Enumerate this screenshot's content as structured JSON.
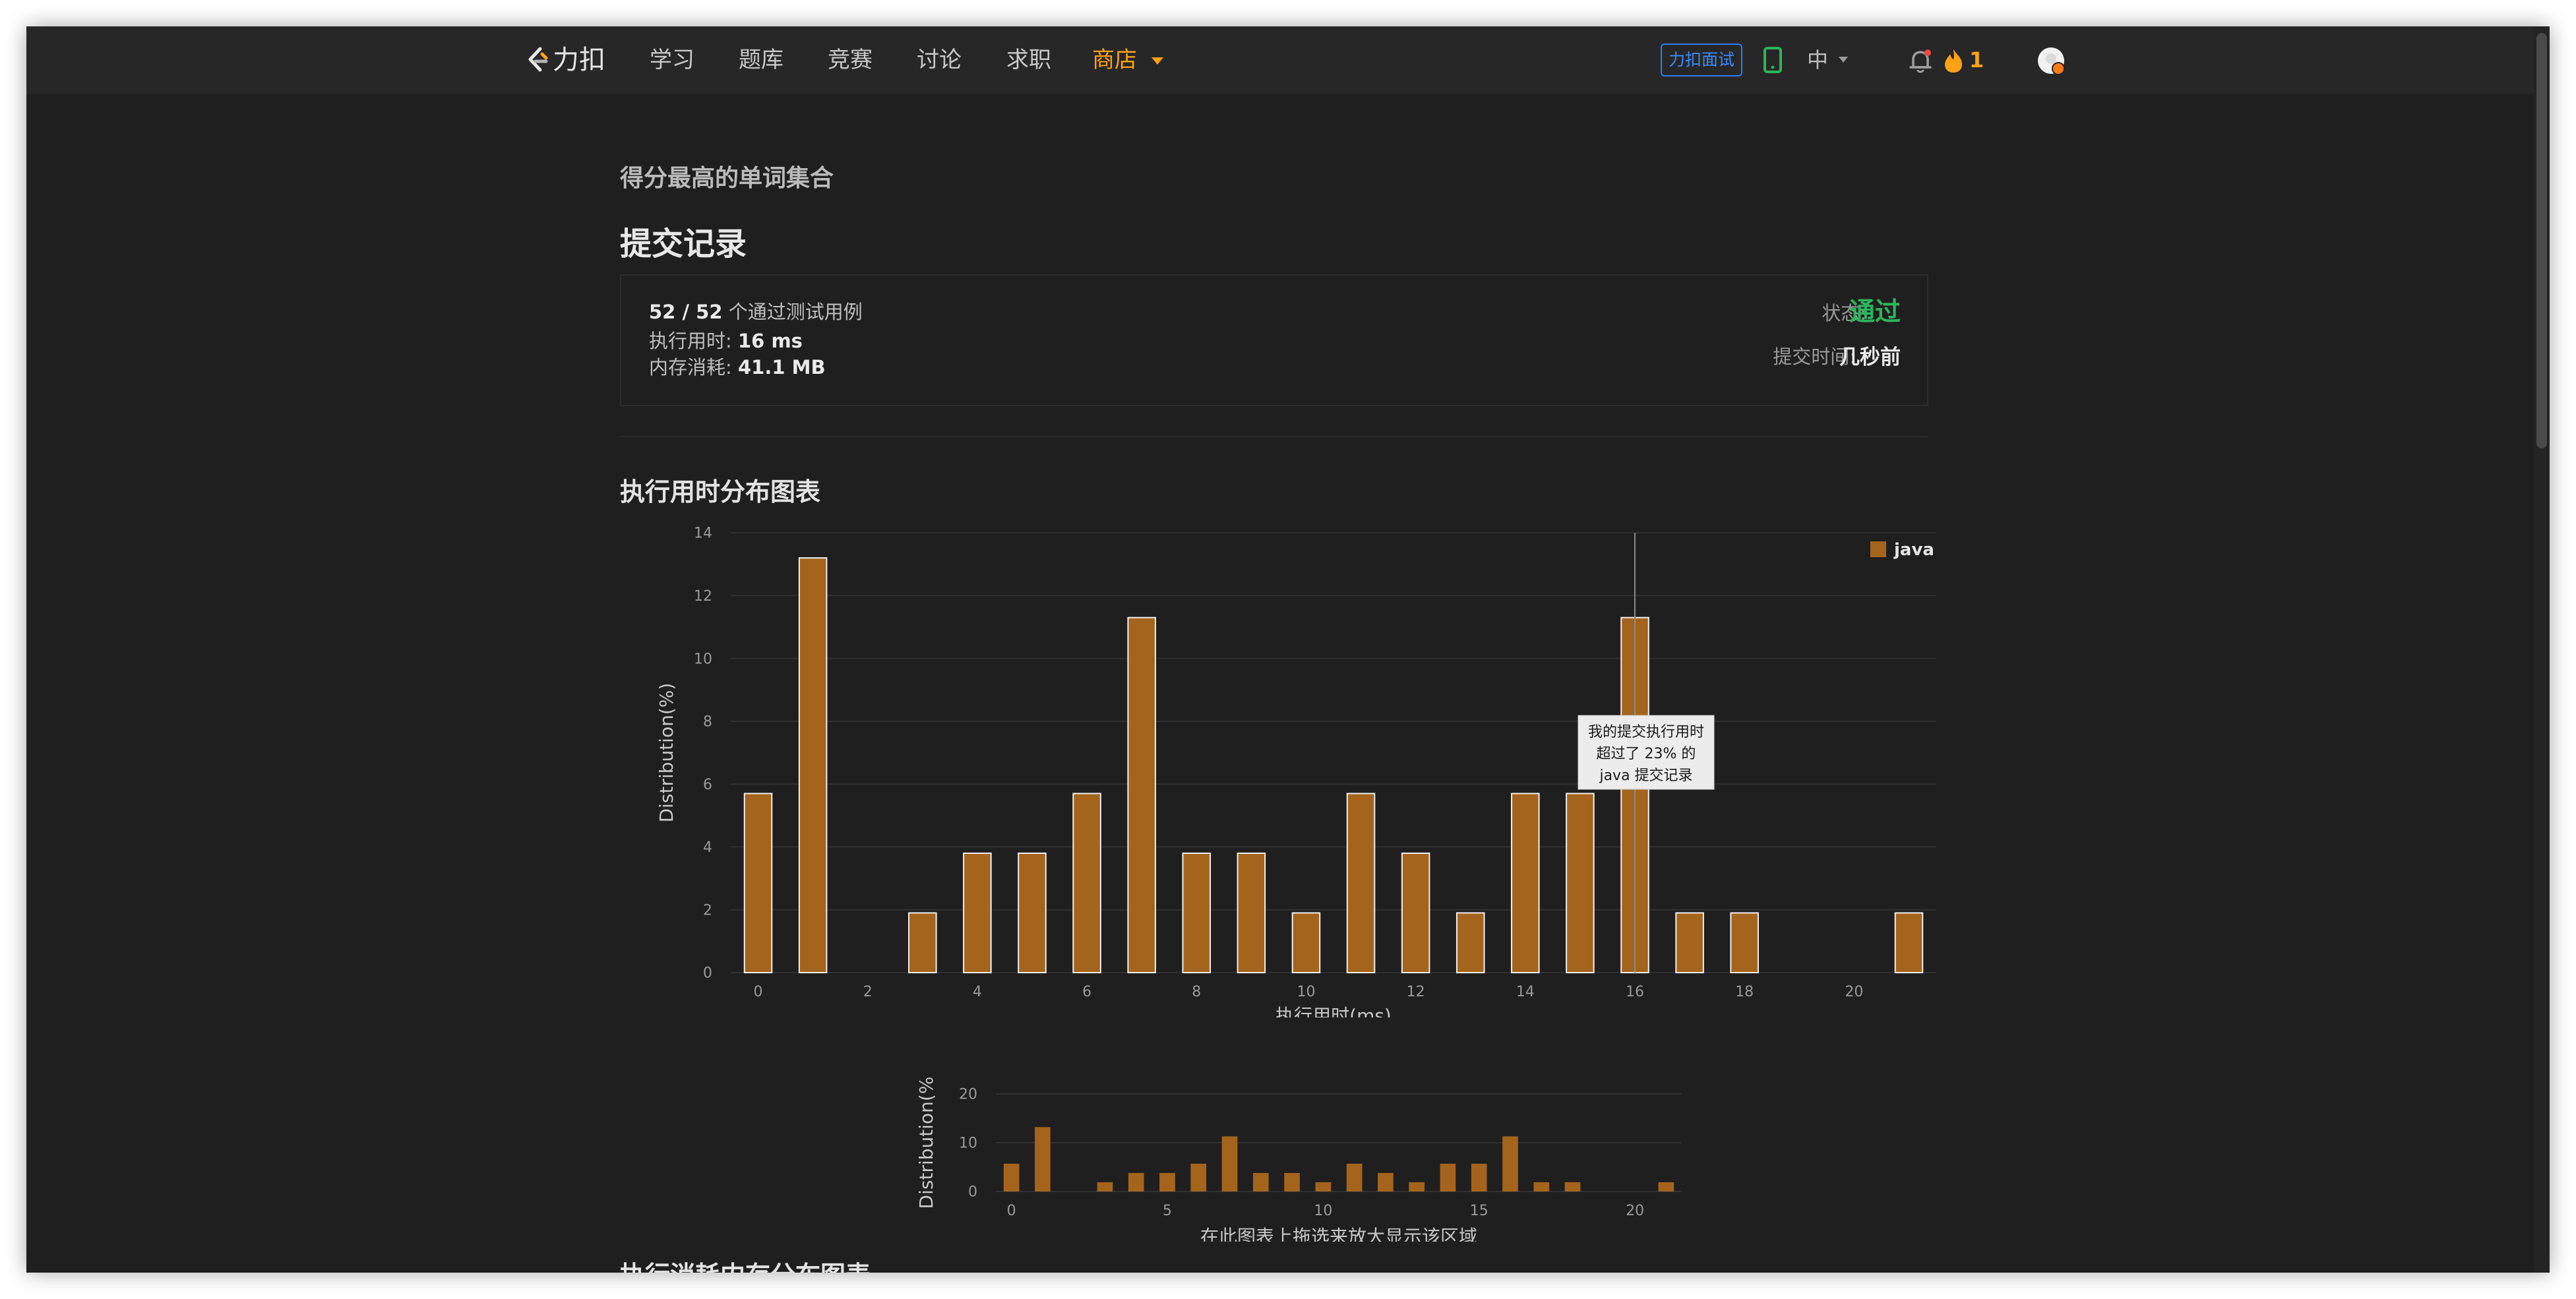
{
  "navbar": {
    "brand": "力扣",
    "items": [
      {
        "label": "学习"
      },
      {
        "label": "题库"
      },
      {
        "label": "竞赛"
      },
      {
        "label": "讨论"
      },
      {
        "label": "求职"
      },
      {
        "label": "商店"
      }
    ],
    "active_item": "商店",
    "interview_button": "力扣面试",
    "language": "中",
    "streak_count": "1",
    "icons": [
      "leetcode-logo-icon",
      "tablet-icon",
      "bell-icon",
      "flame-icon",
      "avatar"
    ],
    "accent_color": "#ffa116"
  },
  "page": {
    "problem_title": "得分最高的单词集合",
    "title": "提交记录"
  },
  "result": {
    "passed": "52 / 52",
    "passed_suffix": "个通过测试用例",
    "runtime_label": "执行用时:",
    "runtime_value": "16 ms",
    "memory_label": "内存消耗:",
    "memory_value": "41.1 MB",
    "status_label": "状态:",
    "status_value": "通过",
    "status_color": "#2db55d",
    "submit_time_label": "提交时间:",
    "submit_time_value": "几秒前"
  },
  "charts": {
    "runtime_title": "执行用时分布图表",
    "memory_title": "执行消耗内存分布图表"
  },
  "chart_data": [
    {
      "type": "bar",
      "title": "执行用时分布图表",
      "xlabel": "执行用时(ms)",
      "ylabel": "Distribution(%)",
      "legend": [
        "java"
      ],
      "legend_position": "top-right",
      "bar_color": "#a5641c",
      "series": [
        {
          "name": "java",
          "x": [
            0,
            1,
            3,
            4,
            5,
            6,
            7,
            8,
            9,
            10,
            11,
            12,
            13,
            14,
            15,
            16,
            17,
            18,
            21
          ],
          "values": [
            5.7,
            13.2,
            1.9,
            3.8,
            3.8,
            5.7,
            11.3,
            3.8,
            3.8,
            1.9,
            5.7,
            3.8,
            1.9,
            5.7,
            5.7,
            11.3,
            1.9,
            1.9,
            1.9
          ]
        }
      ],
      "xlim": [
        -0.5,
        21.5
      ],
      "ylim": [
        0,
        14
      ],
      "x_ticks": [
        0,
        2,
        4,
        6,
        8,
        10,
        12,
        14,
        16,
        18,
        20
      ],
      "y_ticks": [
        0,
        2,
        4,
        6,
        8,
        10,
        12,
        14
      ],
      "grid": true,
      "highlight": {
        "x": 16,
        "tooltip_lines": [
          "我的提交执行用时",
          "超过了 23% 的",
          "java 提交记录"
        ]
      }
    },
    {
      "type": "bar",
      "title": "",
      "xlabel": "在此图表上拖选来放大显示该区域",
      "ylabel": "Distribution(%",
      "bar_color": "#a5641c",
      "series": [
        {
          "name": "java",
          "x": [
            0,
            1,
            3,
            4,
            5,
            6,
            7,
            8,
            9,
            10,
            11,
            12,
            13,
            14,
            15,
            16,
            17,
            18,
            21
          ],
          "values": [
            5.7,
            13.2,
            1.9,
            3.8,
            3.8,
            5.7,
            11.3,
            3.8,
            3.8,
            1.9,
            5.7,
            3.8,
            1.9,
            5.7,
            5.7,
            11.3,
            1.9,
            1.9,
            1.9
          ]
        }
      ],
      "xlim": [
        -0.5,
        21.5
      ],
      "ylim": [
        0,
        20
      ],
      "x_ticks": [
        0,
        5,
        10,
        15,
        20
      ],
      "y_ticks": [
        0,
        10,
        20
      ],
      "grid": true
    }
  ]
}
